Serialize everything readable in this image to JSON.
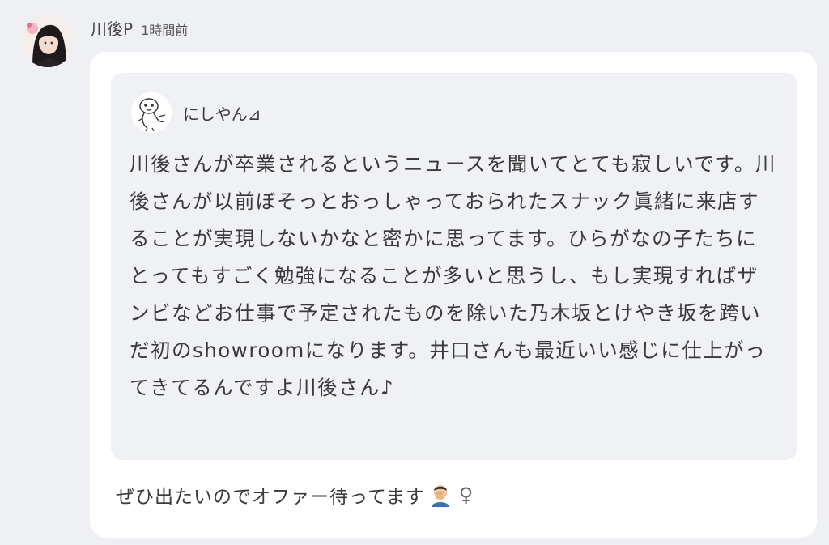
{
  "post": {
    "username": "川後P",
    "timestamp": "1時間前",
    "avatar_icon": "user-avatar-photo"
  },
  "quote": {
    "name": "にしやん⊿",
    "avatar_icon": "cartoon-character-avatar",
    "text": "川後さんが卒業されるというニュースを聞いてとても寂しいです。川後さんが以前ぼそっとおっしゃっておられたスナック眞緒に来店することが実現しないかなと密かに思ってます。ひらがなの子たちにとってもすごく勉強になることが多いと思うし、もし実現すればザンビなどお仕事で予定されたものを除いた乃木坂とけやき坂を跨いだ初のshowroomになります。井口さんも最近いい感じに仕上がってきてるんですよ川後さん♪"
  },
  "reply": {
    "text": "ぜひ出たいのでオファー待ってます",
    "emoji_icon": "man-facepalming-emoji",
    "symbol": "♀"
  },
  "colors": {
    "page_background": "#eef0f4",
    "bubble_background": "#ffffff",
    "quote_background": "#f0f1f5",
    "text": "#3a3a3a"
  }
}
